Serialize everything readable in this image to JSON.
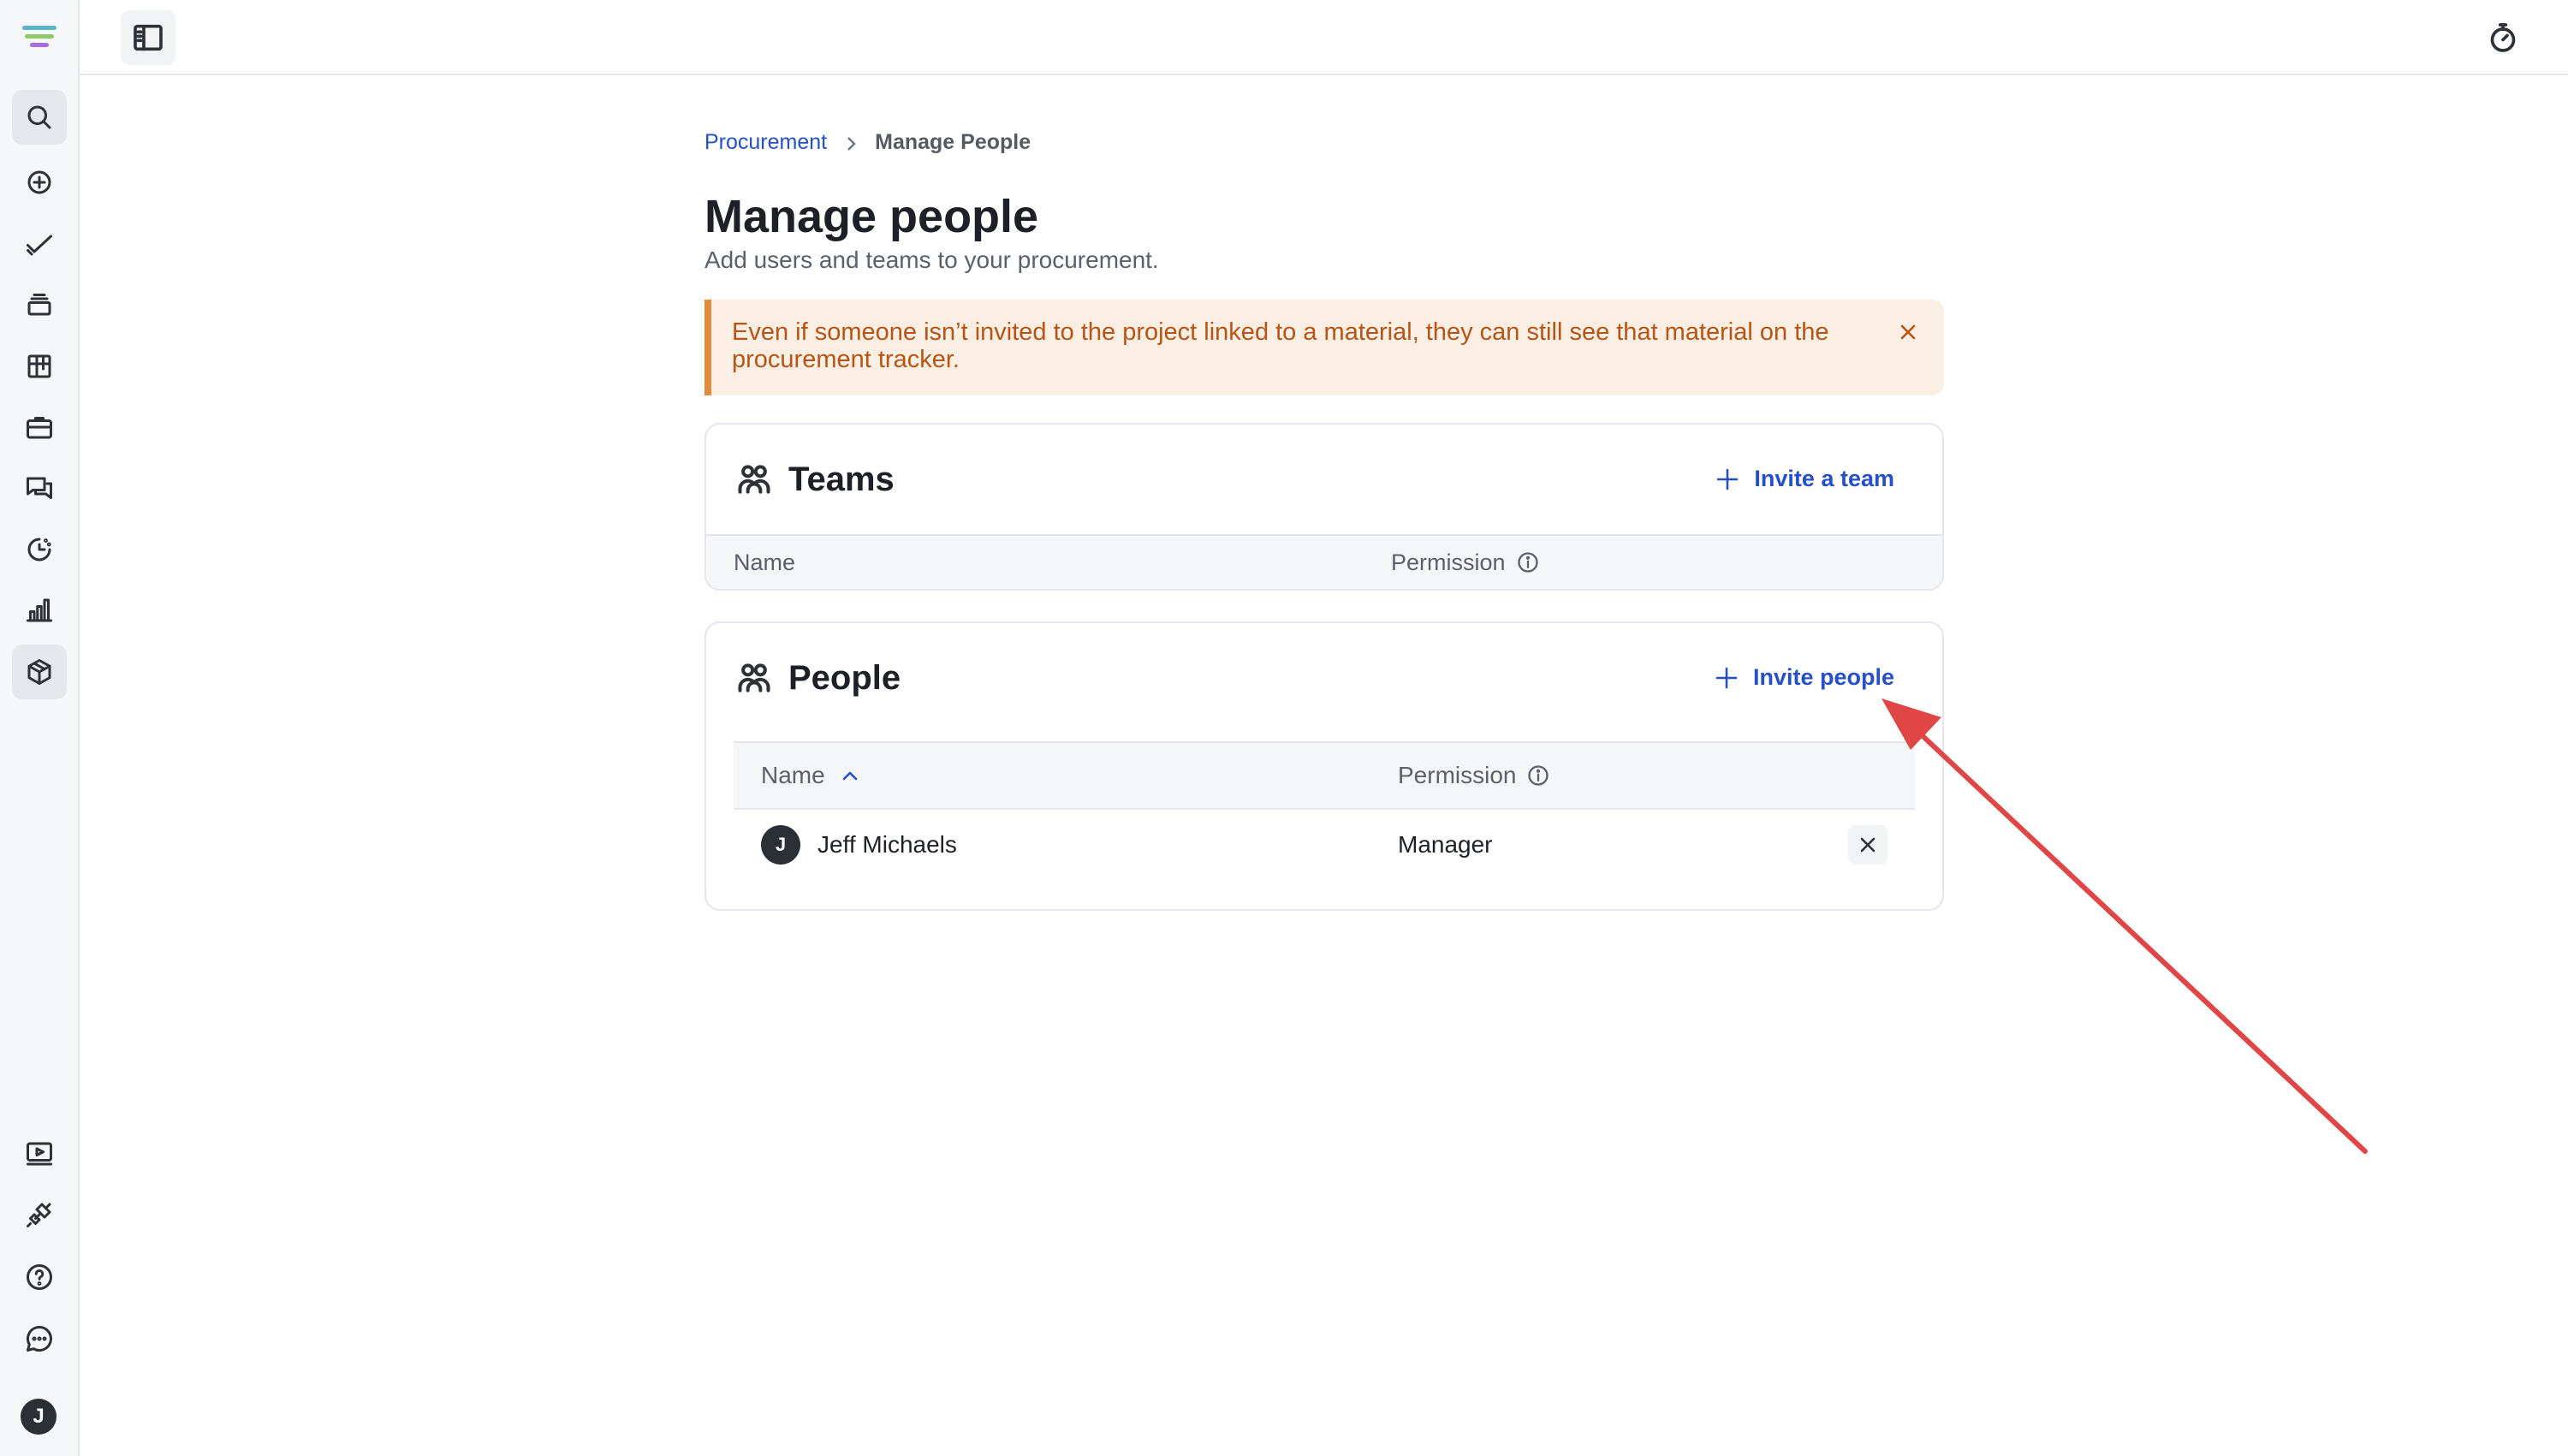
{
  "breadcrumb": {
    "parent": "Procurement",
    "current": "Manage People"
  },
  "page": {
    "title": "Manage people",
    "subtitle": "Add users and teams to your procurement."
  },
  "banner": {
    "message": "Even if someone isn’t invited to the project linked to a material, they can still see that material on the procurement tracker."
  },
  "teams": {
    "title": "Teams",
    "invite_label": "Invite a team",
    "columns": {
      "name": "Name",
      "permission": "Permission"
    }
  },
  "people": {
    "title": "People",
    "invite_label": "Invite people",
    "columns": {
      "name": "Name",
      "permission": "Permission"
    },
    "rows": [
      {
        "initial": "J",
        "name": "Jeff Michaels",
        "permission": "Manager"
      }
    ]
  },
  "user": {
    "initial": "J"
  },
  "colors": {
    "accent": "#2550c8",
    "banner_bg": "#fbeee3",
    "banner_text": "#b85416",
    "annotation_arrow": "#e04646"
  },
  "icons": {
    "rail": [
      "search-icon",
      "add-circle-icon",
      "checkmark-icon",
      "stack-icon",
      "board-icon",
      "briefcase-icon",
      "chat-icon",
      "timeline-icon",
      "bar-chart-icon",
      "package-icon"
    ],
    "rail_bottom": [
      "video-icon",
      "plug-icon",
      "help-icon",
      "message-icon"
    ]
  }
}
